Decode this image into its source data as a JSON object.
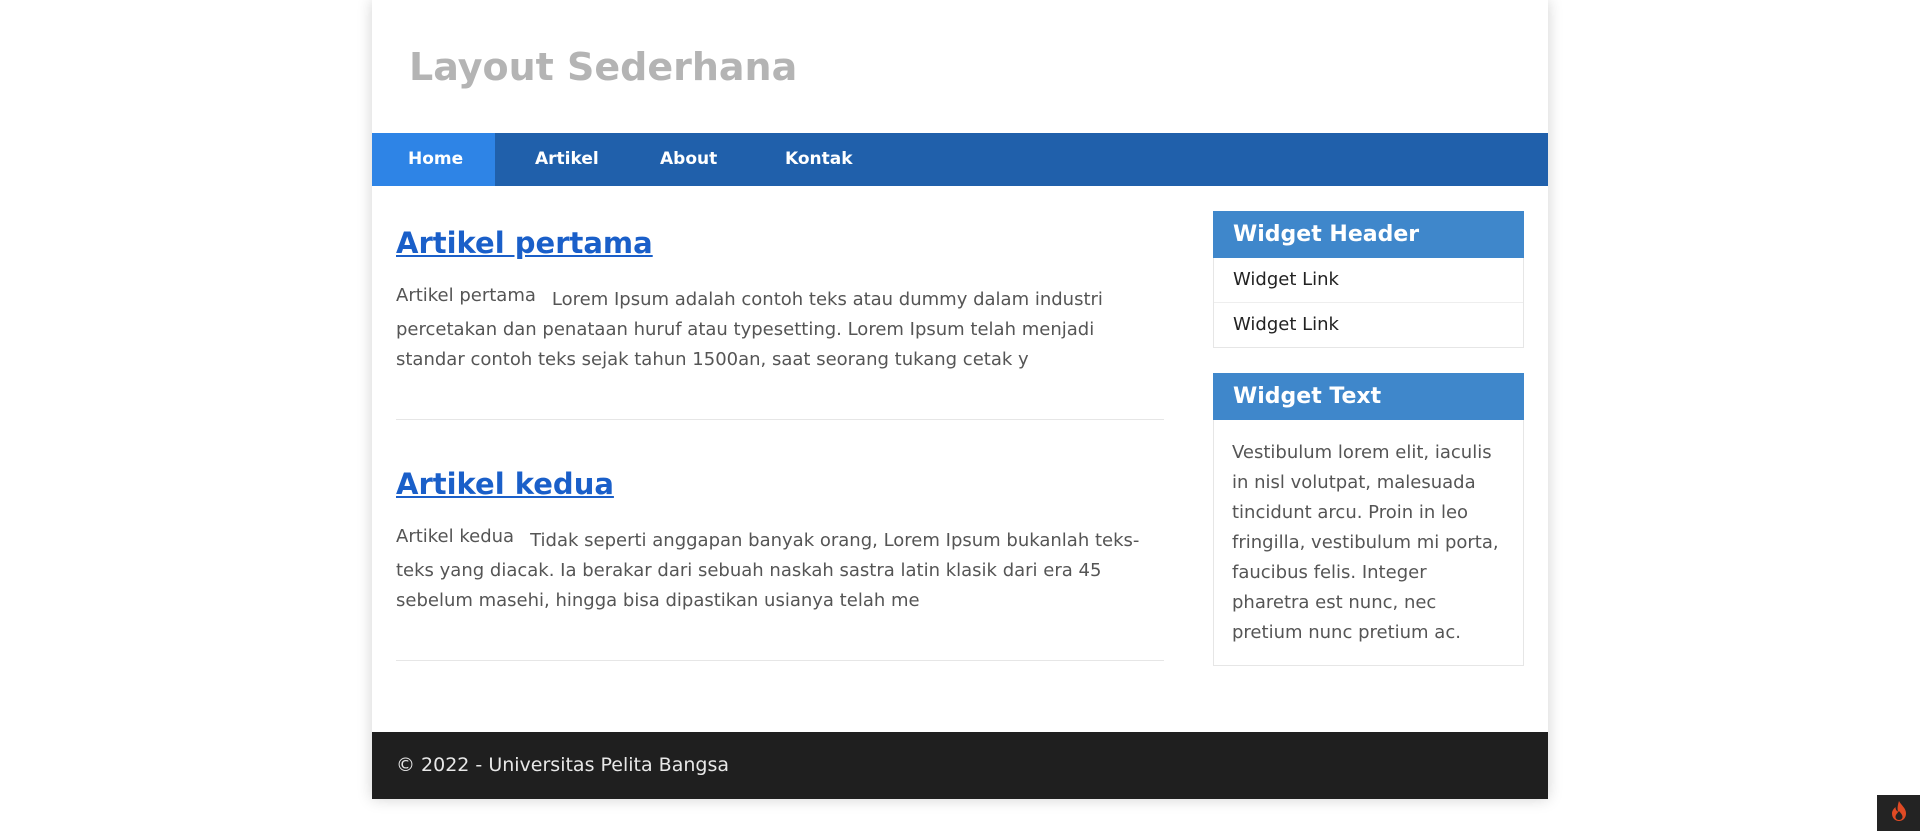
{
  "site": {
    "title": "Layout Sederhana"
  },
  "nav": {
    "items": [
      "Home",
      "Artikel",
      "About",
      "Kontak"
    ],
    "active_index": 0
  },
  "articles": [
    {
      "title": "Artikel pertama",
      "lead": "Artikel pertama",
      "body": "Lorem Ipsum adalah contoh teks atau dummy dalam industri percetakan dan penataan huruf atau typesetting. Lorem Ipsum telah menjadi standar contoh teks sejak tahun 1500an, saat seorang tukang cetak y"
    },
    {
      "title": "Artikel kedua",
      "lead": "Artikel kedua",
      "body": "Tidak seperti anggapan banyak orang, Lorem Ipsum bukanlah teks-teks yang diacak. Ia berakar dari sebuah naskah sastra latin klasik dari era 45 sebelum masehi, hingga bisa dipastikan usianya telah me"
    }
  ],
  "sidebar": {
    "widget1": {
      "header": "Widget Header",
      "links": [
        "Widget Link",
        "Widget Link"
      ]
    },
    "widget2": {
      "header": "Widget Text",
      "text": "Vestibulum lorem elit, iaculis in nisl volutpat, malesuada tincidunt arcu. Proin in leo fringilla, vestibulum mi porta, faucibus felis. Integer pharetra est nunc, nec pretium nunc pretium ac."
    }
  },
  "footer": {
    "text": "© 2022 - Universitas Pelita Bangsa"
  },
  "debug_toolbar": {
    "icon": "flame-icon"
  },
  "colors": {
    "nav_bg": "#2060ab",
    "nav_active": "#2e84e6",
    "widget_header": "#3f87cb",
    "link": "#1a5fc9",
    "footer_bg": "#1f1f1f",
    "title": "#b4b4b4"
  }
}
